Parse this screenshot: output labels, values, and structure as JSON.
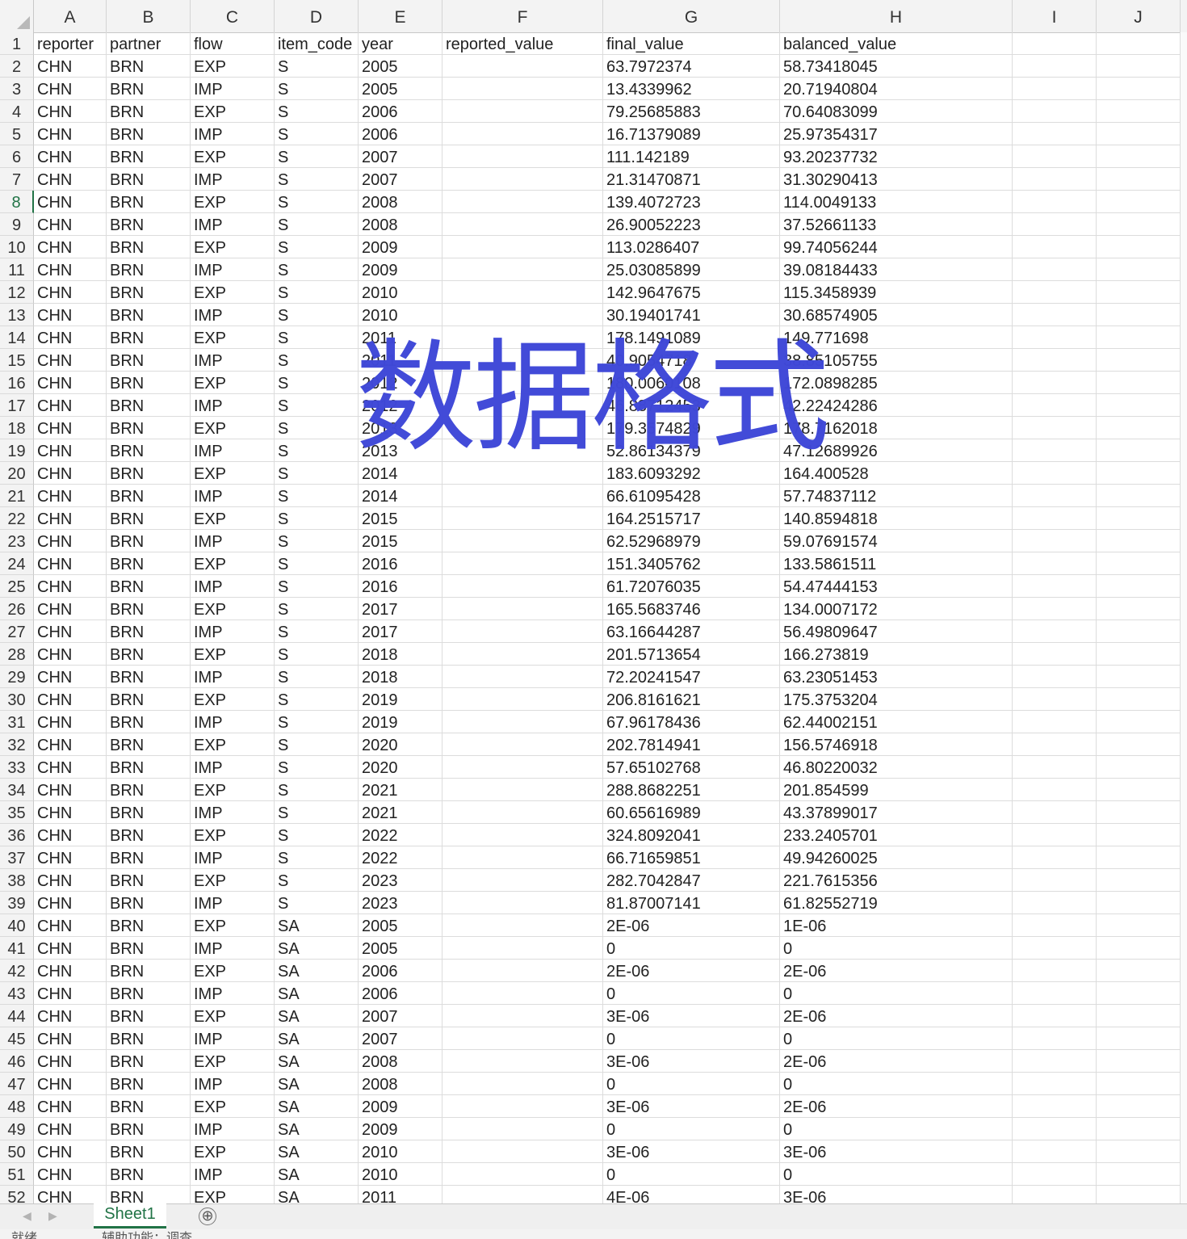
{
  "columns": [
    "A",
    "B",
    "C",
    "D",
    "E",
    "F",
    "G",
    "H",
    "I",
    "J"
  ],
  "rows": [
    [
      "1",
      "reporter",
      "partner",
      "flow",
      "item_code",
      "year",
      "reported_value",
      "final_value",
      "balanced_value",
      "",
      ""
    ],
    [
      "2",
      "CHN",
      "BRN",
      "EXP",
      "S",
      "2005",
      "",
      "63.7972374",
      "58.73418045",
      "",
      ""
    ],
    [
      "3",
      "CHN",
      "BRN",
      "IMP",
      "S",
      "2005",
      "",
      "13.4339962",
      "20.71940804",
      "",
      ""
    ],
    [
      "4",
      "CHN",
      "BRN",
      "EXP",
      "S",
      "2006",
      "",
      "79.25685883",
      "70.64083099",
      "",
      ""
    ],
    [
      "5",
      "CHN",
      "BRN",
      "IMP",
      "S",
      "2006",
      "",
      "16.71379089",
      "25.97354317",
      "",
      ""
    ],
    [
      "6",
      "CHN",
      "BRN",
      "EXP",
      "S",
      "2007",
      "",
      "111.142189",
      "93.20237732",
      "",
      ""
    ],
    [
      "7",
      "CHN",
      "BRN",
      "IMP",
      "S",
      "2007",
      "",
      "21.31470871",
      "31.30290413",
      "",
      ""
    ],
    [
      "8",
      "CHN",
      "BRN",
      "EXP",
      "S",
      "2008",
      "",
      "139.4072723",
      "114.0049133",
      "",
      ""
    ],
    [
      "9",
      "CHN",
      "BRN",
      "IMP",
      "S",
      "2008",
      "",
      "26.90052223",
      "37.52661133",
      "",
      ""
    ],
    [
      "10",
      "CHN",
      "BRN",
      "EXP",
      "S",
      "2009",
      "",
      "113.0286407",
      "99.74056244",
      "",
      ""
    ],
    [
      "11",
      "CHN",
      "BRN",
      "IMP",
      "S",
      "2009",
      "",
      "25.03085899",
      "39.08184433",
      "",
      ""
    ],
    [
      "12",
      "CHN",
      "BRN",
      "EXP",
      "S",
      "2010",
      "",
      "142.9647675",
      "115.3458939",
      "",
      ""
    ],
    [
      "13",
      "CHN",
      "BRN",
      "IMP",
      "S",
      "2010",
      "",
      "30.19401741",
      "30.68574905",
      "",
      ""
    ],
    [
      "14",
      "CHN",
      "BRN",
      "EXP",
      "S",
      "2011",
      "",
      "178.1491089",
      "149.771698",
      "",
      ""
    ],
    [
      "15",
      "CHN",
      "BRN",
      "IMP",
      "S",
      "2011",
      "",
      "40.9054718",
      "38.85105755",
      "",
      ""
    ],
    [
      "16",
      "CHN",
      "BRN",
      "EXP",
      "S",
      "2012",
      "",
      "180.0060108",
      "172.0898285",
      "",
      ""
    ],
    [
      "17",
      "CHN",
      "BRN",
      "IMP",
      "S",
      "2012",
      "",
      "46.88712453",
      "42.22424286",
      "",
      ""
    ],
    [
      "18",
      "CHN",
      "BRN",
      "EXP",
      "S",
      "2013",
      "",
      "179.3574829",
      "178.7162018",
      "",
      ""
    ],
    [
      "19",
      "CHN",
      "BRN",
      "IMP",
      "S",
      "2013",
      "",
      "52.86134379",
      "47.12689926",
      "",
      ""
    ],
    [
      "20",
      "CHN",
      "BRN",
      "EXP",
      "S",
      "2014",
      "",
      "183.6093292",
      "164.400528",
      "",
      ""
    ],
    [
      "21",
      "CHN",
      "BRN",
      "IMP",
      "S",
      "2014",
      "",
      "66.61095428",
      "57.74837112",
      "",
      ""
    ],
    [
      "22",
      "CHN",
      "BRN",
      "EXP",
      "S",
      "2015",
      "",
      "164.2515717",
      "140.8594818",
      "",
      ""
    ],
    [
      "23",
      "CHN",
      "BRN",
      "IMP",
      "S",
      "2015",
      "",
      "62.52968979",
      "59.07691574",
      "",
      ""
    ],
    [
      "24",
      "CHN",
      "BRN",
      "EXP",
      "S",
      "2016",
      "",
      "151.3405762",
      "133.5861511",
      "",
      ""
    ],
    [
      "25",
      "CHN",
      "BRN",
      "IMP",
      "S",
      "2016",
      "",
      "61.72076035",
      "54.47444153",
      "",
      ""
    ],
    [
      "26",
      "CHN",
      "BRN",
      "EXP",
      "S",
      "2017",
      "",
      "165.5683746",
      "134.0007172",
      "",
      ""
    ],
    [
      "27",
      "CHN",
      "BRN",
      "IMP",
      "S",
      "2017",
      "",
      "63.16644287",
      "56.49809647",
      "",
      ""
    ],
    [
      "28",
      "CHN",
      "BRN",
      "EXP",
      "S",
      "2018",
      "",
      "201.5713654",
      "166.273819",
      "",
      ""
    ],
    [
      "29",
      "CHN",
      "BRN",
      "IMP",
      "S",
      "2018",
      "",
      "72.20241547",
      "63.23051453",
      "",
      ""
    ],
    [
      "30",
      "CHN",
      "BRN",
      "EXP",
      "S",
      "2019",
      "",
      "206.8161621",
      "175.3753204",
      "",
      ""
    ],
    [
      "31",
      "CHN",
      "BRN",
      "IMP",
      "S",
      "2019",
      "",
      "67.96178436",
      "62.44002151",
      "",
      ""
    ],
    [
      "32",
      "CHN",
      "BRN",
      "EXP",
      "S",
      "2020",
      "",
      "202.7814941",
      "156.5746918",
      "",
      ""
    ],
    [
      "33",
      "CHN",
      "BRN",
      "IMP",
      "S",
      "2020",
      "",
      "57.65102768",
      "46.80220032",
      "",
      ""
    ],
    [
      "34",
      "CHN",
      "BRN",
      "EXP",
      "S",
      "2021",
      "",
      "288.8682251",
      "201.854599",
      "",
      ""
    ],
    [
      "35",
      "CHN",
      "BRN",
      "IMP",
      "S",
      "2021",
      "",
      "60.65616989",
      "43.37899017",
      "",
      ""
    ],
    [
      "36",
      "CHN",
      "BRN",
      "EXP",
      "S",
      "2022",
      "",
      "324.8092041",
      "233.2405701",
      "",
      ""
    ],
    [
      "37",
      "CHN",
      "BRN",
      "IMP",
      "S",
      "2022",
      "",
      "66.71659851",
      "49.94260025",
      "",
      ""
    ],
    [
      "38",
      "CHN",
      "BRN",
      "EXP",
      "S",
      "2023",
      "",
      "282.7042847",
      "221.7615356",
      "",
      ""
    ],
    [
      "39",
      "CHN",
      "BRN",
      "IMP",
      "S",
      "2023",
      "",
      "81.87007141",
      "61.82552719",
      "",
      ""
    ],
    [
      "40",
      "CHN",
      "BRN",
      "EXP",
      "SA",
      "2005",
      "",
      "2E-06",
      "1E-06",
      "",
      ""
    ],
    [
      "41",
      "CHN",
      "BRN",
      "IMP",
      "SA",
      "2005",
      "",
      "0",
      "0",
      "",
      ""
    ],
    [
      "42",
      "CHN",
      "BRN",
      "EXP",
      "SA",
      "2006",
      "",
      "2E-06",
      "2E-06",
      "",
      ""
    ],
    [
      "43",
      "CHN",
      "BRN",
      "IMP",
      "SA",
      "2006",
      "",
      "0",
      "0",
      "",
      ""
    ],
    [
      "44",
      "CHN",
      "BRN",
      "EXP",
      "SA",
      "2007",
      "",
      "3E-06",
      "2E-06",
      "",
      ""
    ],
    [
      "45",
      "CHN",
      "BRN",
      "IMP",
      "SA",
      "2007",
      "",
      "0",
      "0",
      "",
      ""
    ],
    [
      "46",
      "CHN",
      "BRN",
      "EXP",
      "SA",
      "2008",
      "",
      "3E-06",
      "2E-06",
      "",
      ""
    ],
    [
      "47",
      "CHN",
      "BRN",
      "IMP",
      "SA",
      "2008",
      "",
      "0",
      "0",
      "",
      ""
    ],
    [
      "48",
      "CHN",
      "BRN",
      "EXP",
      "SA",
      "2009",
      "",
      "3E-06",
      "2E-06",
      "",
      ""
    ],
    [
      "49",
      "CHN",
      "BRN",
      "IMP",
      "SA",
      "2009",
      "",
      "0",
      "0",
      "",
      ""
    ],
    [
      "50",
      "CHN",
      "BRN",
      "EXP",
      "SA",
      "2010",
      "",
      "3E-06",
      "3E-06",
      "",
      ""
    ],
    [
      "51",
      "CHN",
      "BRN",
      "IMP",
      "SA",
      "2010",
      "",
      "0",
      "0",
      "",
      ""
    ],
    [
      "52",
      "CHN",
      "BRN",
      "EXP",
      "SA",
      "2011",
      "",
      "4E-06",
      "3E-06",
      "",
      ""
    ]
  ],
  "active_row": "8",
  "watermark": "数据格式",
  "sheet_tab": "Sheet1",
  "add_sheet_label": "⊕",
  "nav_prev": "◀",
  "nav_next": "▶",
  "status": [
    "就绪",
    "辅助功能：调查"
  ]
}
